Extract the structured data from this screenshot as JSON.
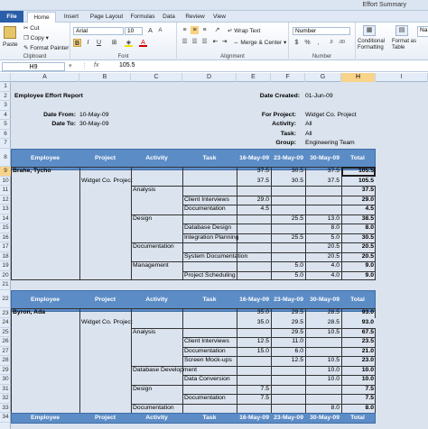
{
  "window": {
    "title": "Effort Summary"
  },
  "tabs": [
    "File",
    "Home",
    "Insert",
    "Page Layout",
    "Formulas",
    "Data",
    "Review",
    "View"
  ],
  "ribbon": {
    "paste": "Paste",
    "cut": "Cut",
    "copy": "Copy",
    "format_painter": "Format Painter",
    "clipboard": "Clipboard",
    "font_name": "Arial",
    "font_size": "10",
    "font": "Font",
    "wrap_text": "Wrap Text",
    "merge_center": "Merge & Center",
    "alignment": "Alignment",
    "number_format": "Number",
    "number": "Number",
    "conditional_formatting": "Conditional Formatting",
    "format_as_table": "Format as Table",
    "styles_partial": "Na"
  },
  "formula": {
    "cell": "H9",
    "fx": "fx",
    "value": "105.5"
  },
  "columns": [
    "A",
    "B",
    "C",
    "D",
    "E",
    "F",
    "G",
    "H",
    "I"
  ],
  "rows": [
    "1",
    "2",
    "3",
    "4",
    "5",
    "6",
    "7",
    "8",
    "9",
    "10",
    "11",
    "12",
    "13",
    "14",
    "15",
    "16",
    "17",
    "18",
    "19",
    "20",
    "21",
    "22",
    "23",
    "24",
    "25",
    "26",
    "27",
    "28",
    "29",
    "30",
    "31",
    "32",
    "33",
    "34"
  ],
  "report": {
    "title": "Employee Effort Report",
    "date_created_label": "Date Created:",
    "date_created": "01-Jun-09",
    "date_from_label": "Date From:",
    "date_from": "10-May-09",
    "date_to_label": "Date To:",
    "date_to": "30-May-09",
    "project_label": "For Project:",
    "project": "Widget Co. Project",
    "activity_label": "Activity:",
    "activity": "All",
    "task_label": "Task:",
    "task": "All",
    "group_label": "Group:",
    "group": "Engineering Team"
  },
  "table_header": [
    "Employee",
    "Project",
    "Activity",
    "Task",
    "16-May-09",
    "23-May-09",
    "30-May-09",
    "Total"
  ],
  "section1": {
    "employee": "Brahe, Tycho",
    "e": "37.5",
    "f": "30.5",
    "g": "37.5",
    "h": "105.5",
    "project": "Widget Co. Project",
    "pe": "37.5",
    "pf": "30.5",
    "pg": "37.5",
    "ph": "105.5",
    "rows": [
      {
        "act": "Analysis",
        "task": "",
        "e": "",
        "f": "",
        "g": "",
        "h": "37.5"
      },
      {
        "act": "",
        "task": "Client Interviews",
        "e": "29.0",
        "f": "",
        "g": "",
        "h": "29.0"
      },
      {
        "act": "",
        "task": "Documentation",
        "e": "4.5",
        "f": "",
        "g": "",
        "h": "4.5"
      },
      {
        "act": "Design",
        "task": "",
        "e": "",
        "f": "25.5",
        "g": "13.0",
        "h": "38.5"
      },
      {
        "act": "",
        "task": "Database Design",
        "e": "",
        "f": "",
        "g": "8.0",
        "h": "8.0"
      },
      {
        "act": "",
        "task": "Integration Planning",
        "e": "",
        "f": "25.5",
        "g": "5.0",
        "h": "30.5"
      },
      {
        "act": "Documentation",
        "task": "",
        "e": "",
        "f": "",
        "g": "20.5",
        "h": "20.5"
      },
      {
        "act": "",
        "task": "System Documentation",
        "e": "",
        "f": "",
        "g": "20.5",
        "h": "20.5"
      },
      {
        "act": "Management",
        "task": "",
        "e": "",
        "f": "5.0",
        "g": "4.0",
        "h": "9.0"
      },
      {
        "act": "",
        "task": "Project Scheduling",
        "e": "",
        "f": "5.0",
        "g": "4.0",
        "h": "9.0"
      }
    ]
  },
  "section2": {
    "employee": "Byron, Ada",
    "e": "35.0",
    "f": "29.5",
    "g": "28.5",
    "h": "93.0",
    "project": "Widget Co. Project",
    "pe": "35.0",
    "pf": "29.5",
    "pg": "28.5",
    "ph": "93.0",
    "rows": [
      {
        "act": "Analysis",
        "task": "",
        "e": "",
        "f": "29.5",
        "g": "10.5",
        "h": "67.5"
      },
      {
        "act": "",
        "task": "Client Interviews",
        "e": "12.5",
        "f": "11.0",
        "g": "",
        "h": "23.5"
      },
      {
        "act": "",
        "task": "Documentation",
        "e": "15.0",
        "f": "6.0",
        "g": "",
        "h": "21.0"
      },
      {
        "act": "",
        "task": "Screen Mock-ups",
        "e": "",
        "f": "12.5",
        "g": "10.5",
        "h": "23.0"
      },
      {
        "act": "Database Development",
        "task": "",
        "e": "",
        "f": "",
        "g": "10.0",
        "h": "10.0"
      },
      {
        "act": "",
        "task": "Data Conversion",
        "e": "",
        "f": "",
        "g": "10.0",
        "h": "10.0"
      },
      {
        "act": "Design",
        "task": "",
        "e": "7.5",
        "f": "",
        "g": "",
        "h": "7.5"
      },
      {
        "act": "",
        "task": "Documentation",
        "e": "7.5",
        "f": "",
        "g": "",
        "h": "7.5"
      },
      {
        "act": "Documentation",
        "task": "",
        "e": "",
        "f": "",
        "g": "8.0",
        "h": "8.0"
      },
      {
        "act": "",
        "task": "User Documentation",
        "e": "",
        "f": "",
        "g": "8.0",
        "h": "8.0"
      }
    ]
  }
}
